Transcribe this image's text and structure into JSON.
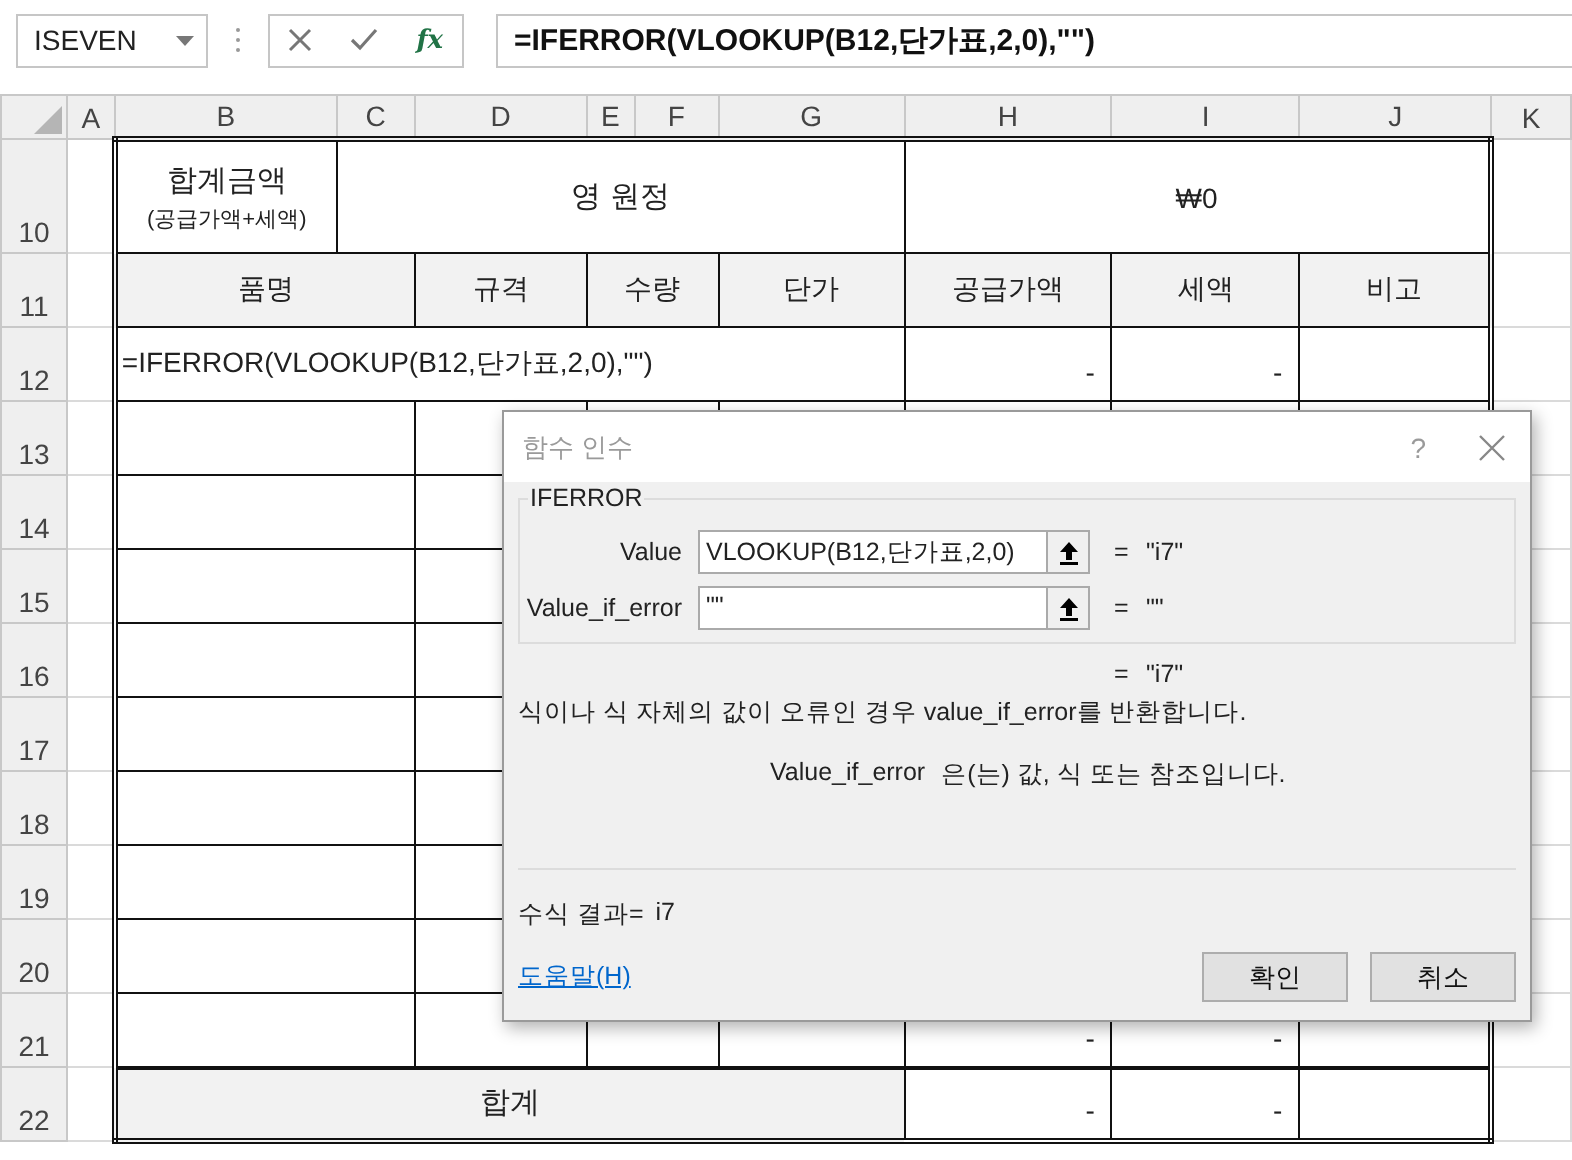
{
  "name_box": {
    "value": "ISEVEN"
  },
  "formula_bar": {
    "function_icon": "fx",
    "formula": "=IFERROR(VLOOKUP(B12,단가표,2,0),\"\")"
  },
  "columns": [
    "A",
    "B",
    "C",
    "D",
    "E",
    "F",
    "G",
    "H",
    "I",
    "J",
    "K"
  ],
  "rows": [
    {
      "number": "10",
      "kind": "summary",
      "label": "합계금액",
      "sublabel": "(공급가액+세액)",
      "amount_words": "영 원정",
      "amount": "₩0"
    },
    {
      "number": "11",
      "kind": "header",
      "cells": [
        "품명",
        "규격",
        "수량",
        "단가",
        "공급가액",
        "세액",
        "비고"
      ]
    },
    {
      "number": "12",
      "kind": "editing",
      "text": "=IFERROR(VLOOKUP(B12,단가표,2,0),\"\")",
      "supply": "-",
      "tax": "-"
    },
    {
      "number": "13",
      "kind": "item"
    },
    {
      "number": "14",
      "kind": "item"
    },
    {
      "number": "15",
      "kind": "item"
    },
    {
      "number": "16",
      "kind": "item"
    },
    {
      "number": "17",
      "kind": "item"
    },
    {
      "number": "18",
      "kind": "item"
    },
    {
      "number": "19",
      "kind": "item"
    },
    {
      "number": "20",
      "kind": "item"
    },
    {
      "number": "21",
      "kind": "item",
      "supply": "-",
      "tax": "-"
    },
    {
      "number": "22",
      "kind": "total",
      "label": "합계",
      "supply": "-",
      "tax": "-"
    }
  ],
  "dialog": {
    "title": "함수 인수",
    "help": "?",
    "function_name": "IFERROR",
    "arguments": [
      {
        "label": "Value",
        "value": "VLOOKUP(B12,단가표,2,0)",
        "equals": "=",
        "result": "\"i7\""
      },
      {
        "label": "Value_if_error",
        "value": "\"\"",
        "equals": "=",
        "result": "\"\""
      }
    ],
    "overall_equals": "=",
    "overall_result": "\"i7\"",
    "description": "식이나 식 자체의 값이 오류인 경우 value_if_error를 반환합니다.",
    "argument_name": "Value_if_error",
    "argument_description": "은(는) 값, 식 또는 참조입니다.",
    "formula_result_label": "수식 결과=",
    "formula_result": "i7",
    "help_link": "도움말(H)",
    "buttons": [
      "확인",
      "취소"
    ]
  }
}
